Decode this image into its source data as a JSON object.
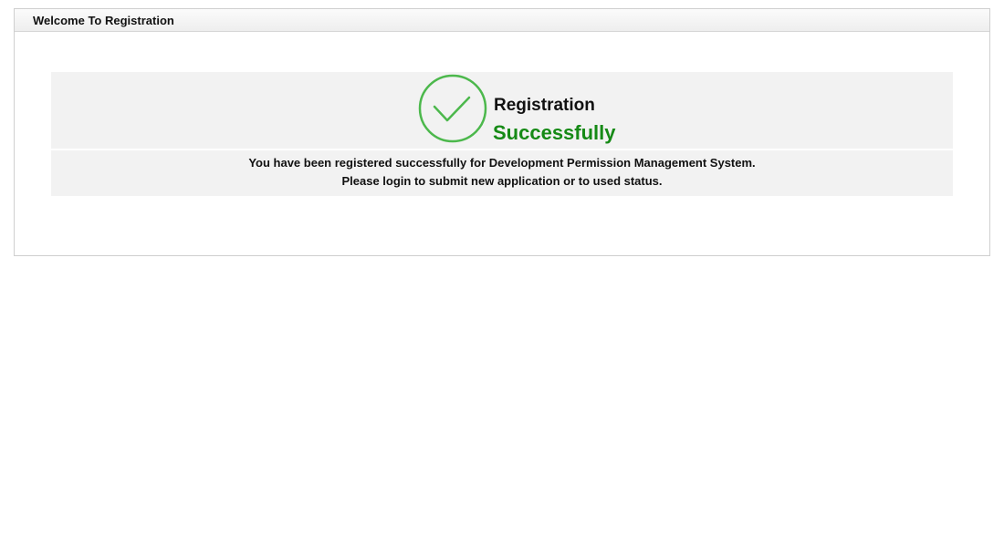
{
  "panel": {
    "header_title": "Welcome To Registration"
  },
  "success": {
    "icon": "check-circle-icon",
    "title": "Registration",
    "subtitle": "Successfully",
    "message_line1": "You have been registered successfully for Development Permission Management System.",
    "message_line2": "Please login to submit new application or to used status.",
    "colors": {
      "accent_green": "#168a16",
      "icon_green": "#4cb84c",
      "box_background": "#f2f2f2"
    }
  }
}
